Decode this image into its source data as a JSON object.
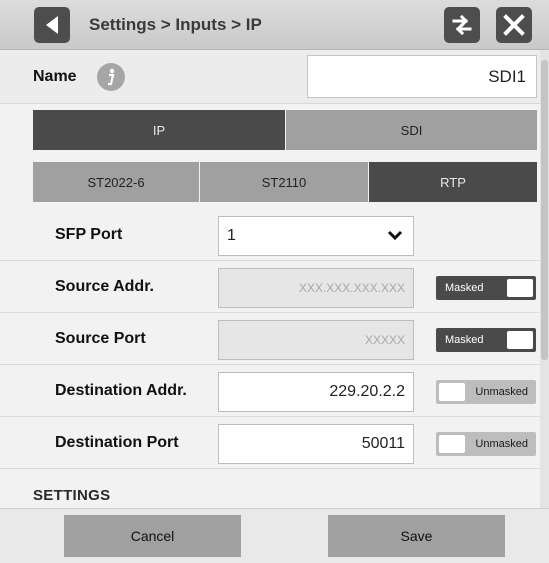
{
  "header": {
    "breadcrumb": "Settings > Inputs > IP",
    "back_icon": "back-arrow-icon",
    "swap_icon": "swap-arrows-icon",
    "close_icon": "close-icon"
  },
  "name_row": {
    "label": "Name",
    "info_icon": "info-icon",
    "value": "SDI1"
  },
  "input_type_tabs": [
    {
      "label": "IP",
      "active": true
    },
    {
      "label": "SDI",
      "active": false
    }
  ],
  "protocol_tabs": [
    {
      "label": "ST2022-6",
      "active": false
    },
    {
      "label": "ST2110",
      "active": false
    },
    {
      "label": "RTP",
      "active": true
    }
  ],
  "fields": {
    "sfp_port": {
      "label": "SFP Port",
      "value": "1"
    },
    "source_addr": {
      "label": "Source Addr.",
      "placeholder": "XXX.XXX.XXX.XXX",
      "toggle": "Masked"
    },
    "source_port": {
      "label": "Source Port",
      "placeholder": "XXXXX",
      "toggle": "Masked"
    },
    "destination_addr": {
      "label": "Destination Addr.",
      "value": "229.20.2.2",
      "toggle": "Unmasked"
    },
    "destination_port": {
      "label": "Destination Port",
      "value": "50011",
      "toggle": "Unmasked"
    }
  },
  "section_title": "SETTINGS",
  "footer": {
    "cancel_label": "Cancel",
    "save_label": "Save"
  },
  "colors": {
    "active_tab": "#4a4a4a",
    "inactive_tab": "#a0a0a0",
    "header_button": "#4d4d4d"
  }
}
